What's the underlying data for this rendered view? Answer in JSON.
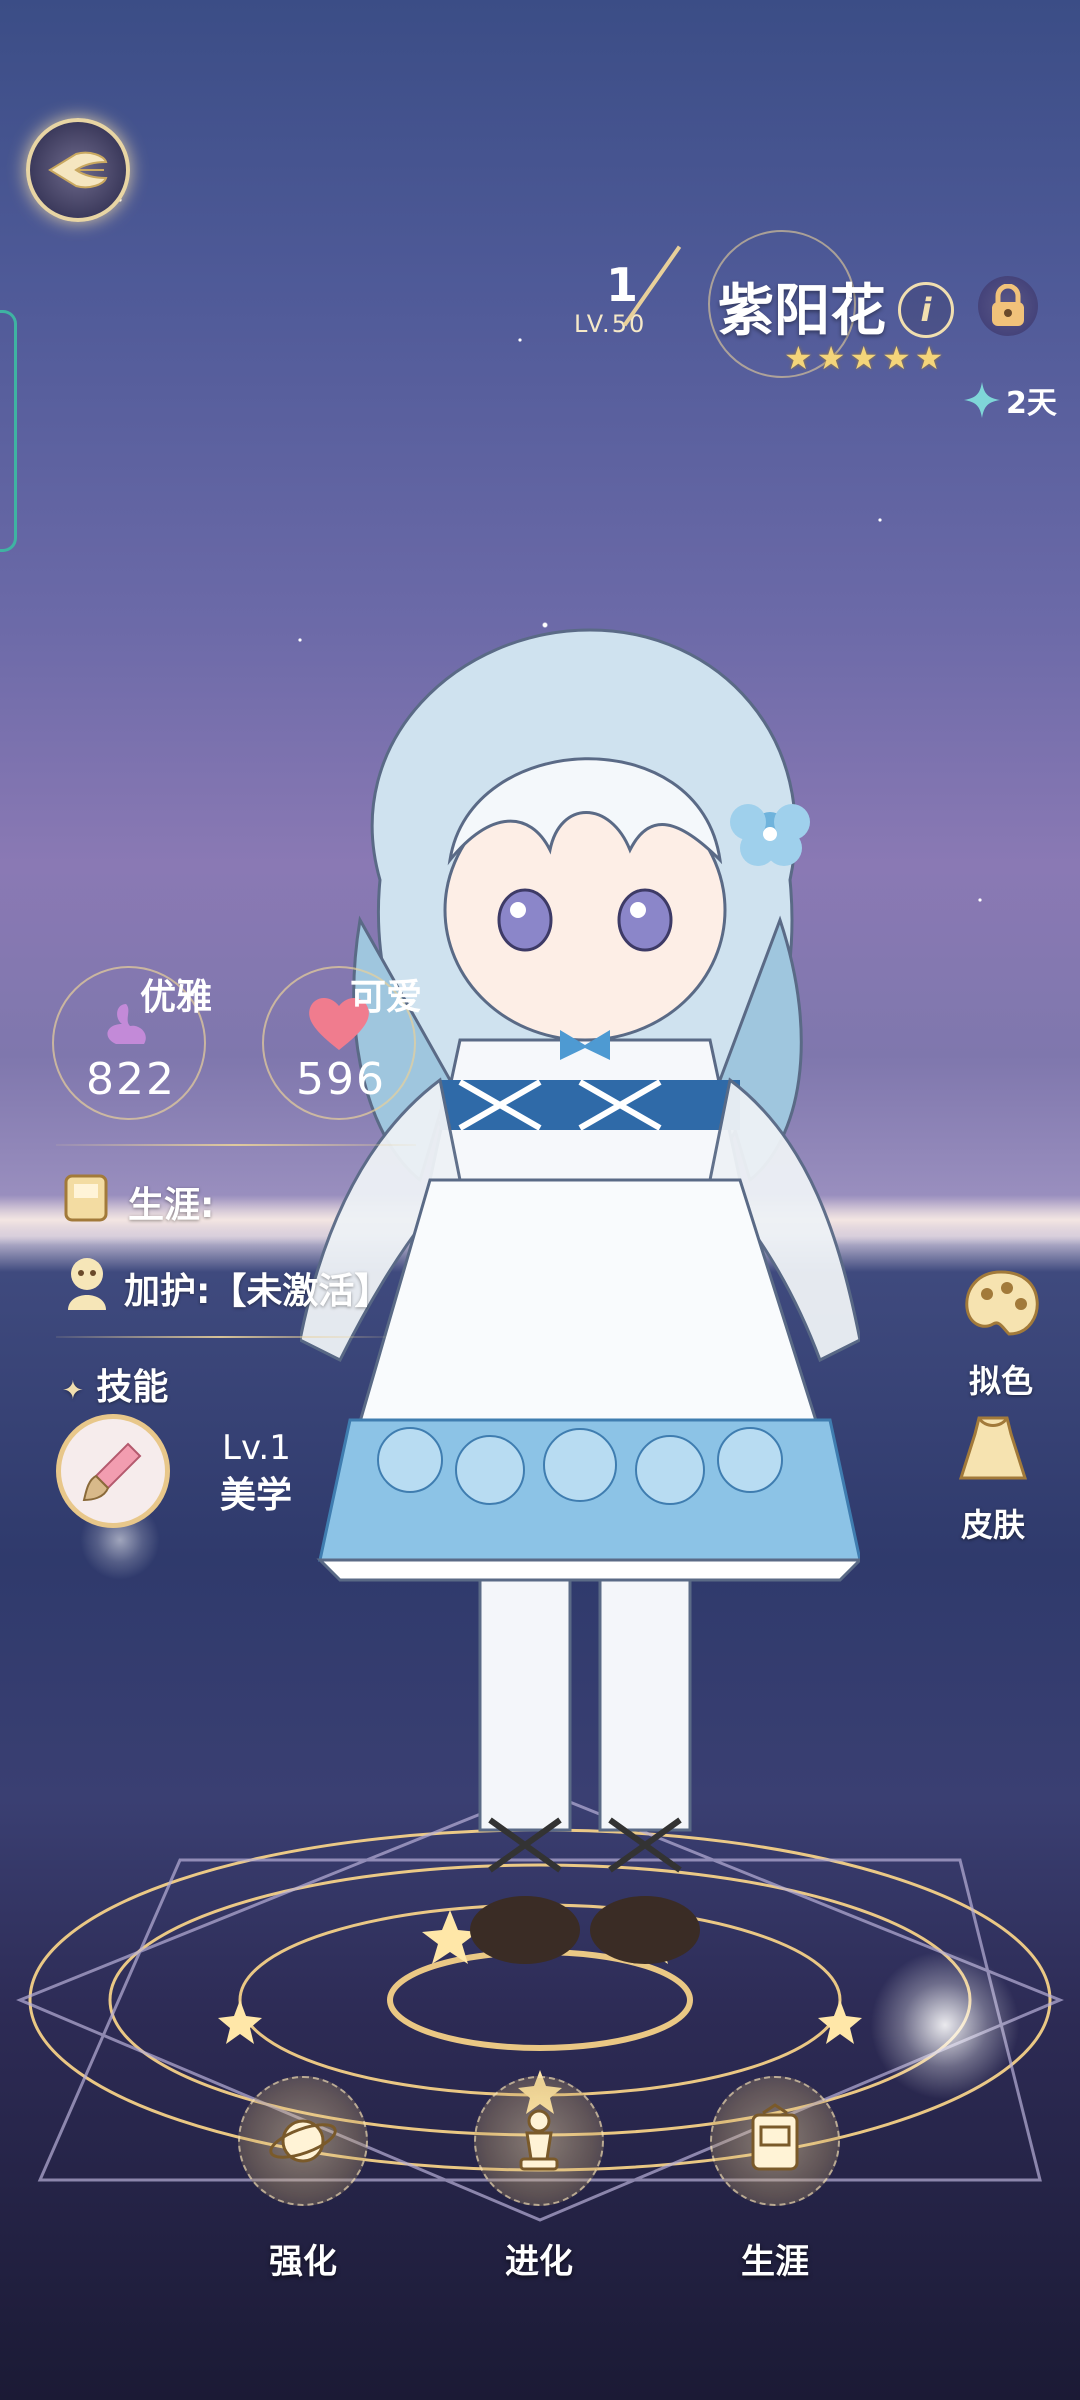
{
  "header": {
    "level_current": "1",
    "level_max": "LV.50",
    "character_name": "紫阳花",
    "info_icon": "info-icon",
    "lock_icon": "lock-icon",
    "rarity_stars": 5,
    "duration_text": "2天"
  },
  "stats": {
    "elegance": {
      "label": "优雅",
      "value": "822"
    },
    "cute": {
      "label": "可爱",
      "value": "596"
    }
  },
  "rows": {
    "career_label": "生涯:",
    "protect_label": "加护:【未激活】",
    "skills_label": "技能"
  },
  "skill": {
    "level": "Lv.1",
    "name": "美学"
  },
  "side_menu": {
    "dye_label": "拟色",
    "skin_label": "皮肤"
  },
  "bottom_menu": {
    "enhance_label": "强化",
    "evolve_label": "进化",
    "career_label": "生涯"
  },
  "colors": {
    "gold": "#e8d09a",
    "star": "#f4d57a",
    "teal": "#3fb3a2"
  }
}
